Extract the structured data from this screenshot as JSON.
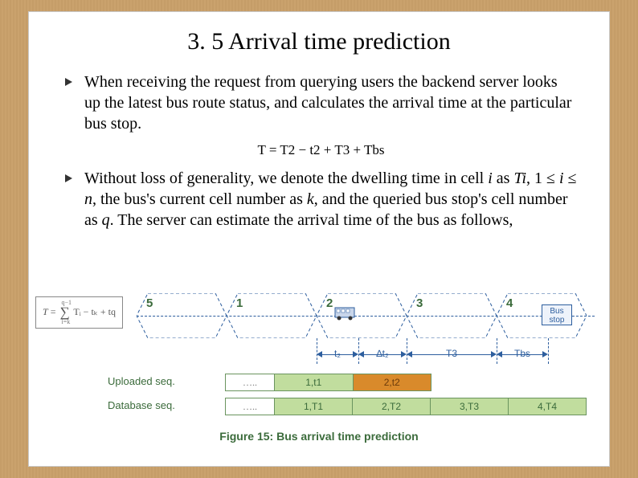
{
  "title": "3. 5 Arrival time prediction",
  "bullets": {
    "b1": "When receiving the request from querying users the backend server looks up the latest bus route status, and calculates the arrival time at the particular bus stop.",
    "b2_pre": "Without loss of generality, we denote the dwelling time in cell ",
    "b2_i1": "i",
    "b2_mid1": " as ",
    "b2_Ti": "Ti",
    "b2_mid2": ", 1 ≤ ",
    "b2_i2": "i",
    "b2_mid3": " ≤ ",
    "b2_n": "n",
    "b2_mid4": ", the bus's current cell number as ",
    "b2_k": "k",
    "b2_mid5": ", and the queried bus stop's cell number as ",
    "b2_q": "q",
    "b2_post": ". The server can estimate the arrival time of the bus as follows,"
  },
  "formula": "T = T2 − t2 + T3 + Tbs",
  "diagram": {
    "eq": {
      "T": "T",
      "sigma_upper": "q−1",
      "sigma_lower": "i=k",
      "body": "Tᵢ − tₖ + tq"
    },
    "hex_labels": [
      "5",
      "1",
      "2",
      "3",
      "4"
    ],
    "bus_stop_label": "Bus\nstop",
    "arrows": [
      "t₂",
      "∆t₂",
      "T3",
      "Tbs"
    ],
    "uploaded_label": "Uploaded seq.",
    "uploaded_cells": [
      "1,t1",
      "2,t2"
    ],
    "database_label": "Database seq.",
    "database_cells": [
      "1,T1",
      "2,T2",
      "3,T3",
      "4,T4"
    ],
    "dots": "…..",
    "caption": "Figure 15: Bus arrival time prediction"
  }
}
